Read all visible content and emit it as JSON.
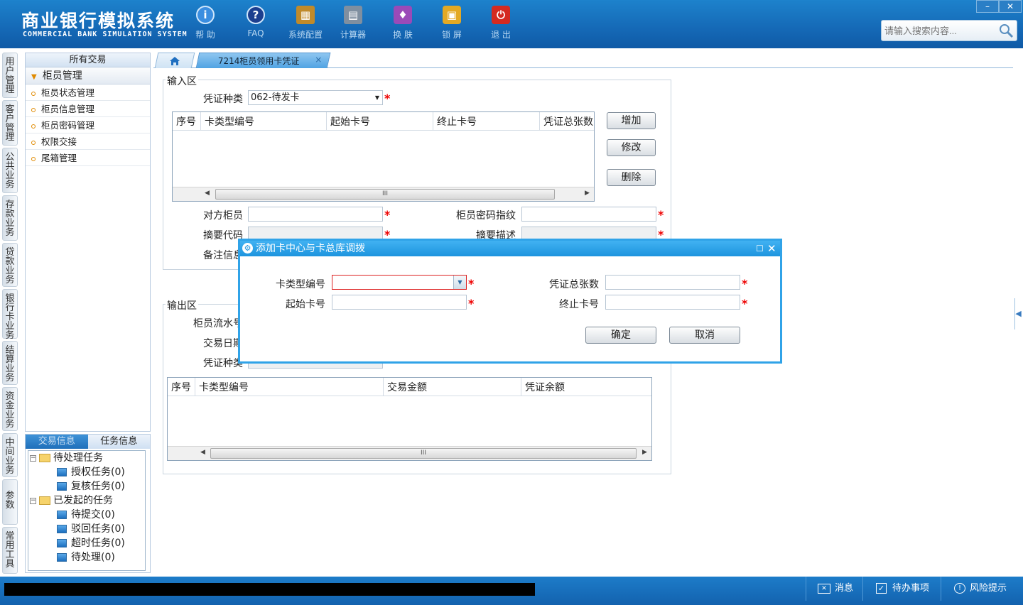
{
  "header": {
    "title_cn": "商业银行模拟系统",
    "title_en": "COMMERCIAL BANK SIMULATION SYSTEM",
    "tools": [
      {
        "label": "帮 助",
        "icon": "info-icon",
        "glyph": "i",
        "color": "#3b8ee0"
      },
      {
        "label": "FAQ",
        "icon": "question-icon",
        "glyph": "?",
        "color": "#1d3f8f"
      },
      {
        "label": "系统配置",
        "icon": "toolbox-icon",
        "glyph": "▦",
        "color": "#c08a2a"
      },
      {
        "label": "计算器",
        "icon": "calculator-icon",
        "glyph": "▤",
        "color": "#7f8fa0"
      },
      {
        "label": "换 肤",
        "icon": "shirt-icon",
        "glyph": "♦",
        "color": "#9a4ab8"
      },
      {
        "label": "锁 屏",
        "icon": "lock-icon",
        "glyph": "🔒",
        "color": "#e3a924"
      },
      {
        "label": "退 出",
        "icon": "power-icon",
        "glyph": "⏻",
        "color": "#d42a20"
      }
    ],
    "search_placeholder": "请输入搜索内容..."
  },
  "vertical_tabs": [
    "用户管理",
    "客户管理",
    "公共业务",
    "存款业务",
    "贷款业务",
    "银行卡业务",
    "结算业务",
    "资金业务",
    "中间业务",
    "参数",
    "常用工具"
  ],
  "sidebar": {
    "header": "所有交易",
    "group": "柜员管理",
    "items": [
      "柜员状态管理",
      "柜员信息管理",
      "柜员密码管理",
      "权限交接",
      "尾箱管理"
    ]
  },
  "task_panel": {
    "tabs": [
      "交易信息",
      "任务信息"
    ],
    "active_tab": "任务信息",
    "pending_group": "待处理任务",
    "pending_items": [
      "授权任务(0)",
      "复核任务(0)"
    ],
    "initiated_group": "已发起的任务",
    "initiated_items": [
      "待提交(0)",
      "驳回任务(0)",
      "超时任务(0)",
      "待处理(0)"
    ]
  },
  "tabs": {
    "open_tab": "7214柜员领用卡凭证"
  },
  "input_area": {
    "legend": "输入区",
    "voucher_type_label": "凭证种类",
    "voucher_type_value": "062-待发卡",
    "grid_columns": [
      "序号",
      "卡类型编号",
      "起始卡号",
      "终止卡号",
      "凭证总张数"
    ],
    "add_button": "增加",
    "edit_button": "修改",
    "delete_button": "删除",
    "counterpart_teller_label": "对方柜员",
    "teller_password_label": "柜员密码指纹",
    "summary_code_label": "摘要代码",
    "summary_desc_label": "摘要描述",
    "remark_label": "备注信息"
  },
  "output_area": {
    "legend": "输出区",
    "teller_serial_label": "柜员流水号",
    "trade_date_label": "交易日期",
    "voucher_type_label": "凭证种类",
    "grid_columns": [
      "序号",
      "卡类型编号",
      "交易金额",
      "凭证余额"
    ]
  },
  "dialog": {
    "title": "添加卡中心与卡总库调拨",
    "card_type_label": "卡类型编号",
    "total_count_label": "凭证总张数",
    "start_card_label": "起始卡号",
    "end_card_label": "终止卡号",
    "ok_button": "确定",
    "cancel_button": "取消"
  },
  "statusbar": {
    "message": "消息",
    "todo": "待办事项",
    "risk": "风险提示"
  },
  "colors": {
    "header_blue": "#1569b6",
    "dialog_border": "#30a3e8",
    "required": "#e00000"
  }
}
